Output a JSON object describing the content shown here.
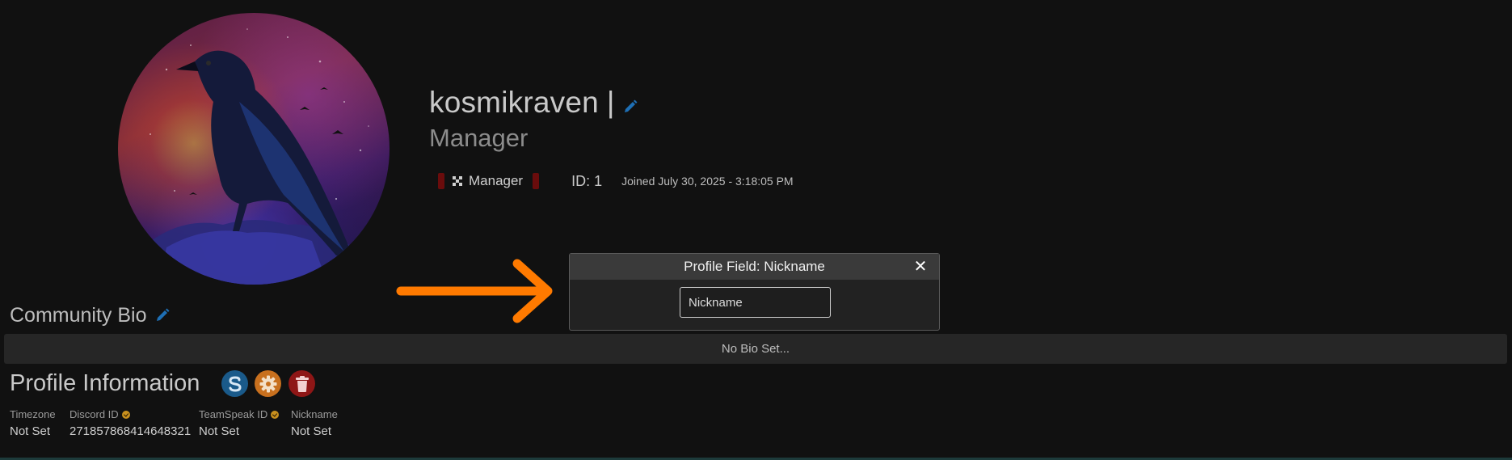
{
  "profile": {
    "username": "kosmikraven",
    "username_separator": "|",
    "role_title": "Manager",
    "badge_label": "Manager",
    "id_text": "ID: 1",
    "joined_text": "Joined July 30, 2025 - 3:18:05 PM"
  },
  "modal": {
    "title": "Profile Field: Nickname",
    "close_glyph": "✕",
    "input_placeholder": "Nickname"
  },
  "bio": {
    "title": "Community Bio",
    "empty_text": "No Bio Set..."
  },
  "info": {
    "title": "Profile Information",
    "fields": [
      {
        "label": "Timezone",
        "value": "Not Set"
      },
      {
        "label": "Discord ID",
        "value": "271857868414648321"
      },
      {
        "label": "TeamSpeak ID",
        "value": "Not Set"
      },
      {
        "label": "Nickname",
        "value": "Not Set"
      }
    ]
  },
  "colors": {
    "background": "#111111",
    "edit_icon": "#1e6fb5",
    "arrow": "#ff7a00",
    "badge_bracket": "#6a0c0c",
    "verified_dot": "#c8901e"
  },
  "icons": [
    "pencil-icon",
    "arrow-right-icon",
    "close-icon",
    "steam-icon",
    "gear-icon",
    "trash-icon",
    "verified-icon",
    "badge-icon"
  ]
}
